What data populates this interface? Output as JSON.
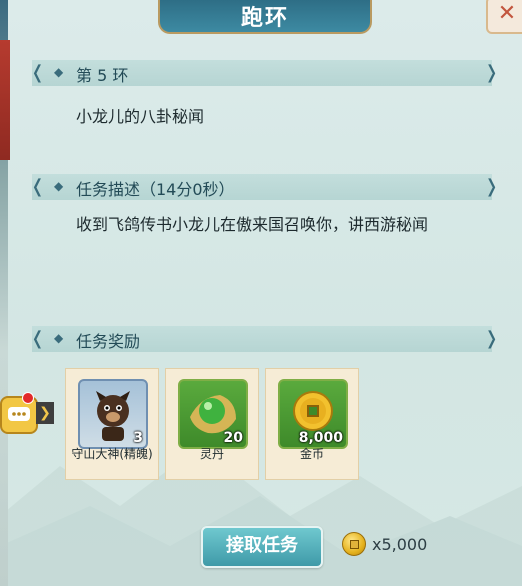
{
  "window": {
    "title": "跑环",
    "close_label": "✕"
  },
  "sections": {
    "ring": {
      "label": "第 5 环",
      "content": "小龙儿的八卦秘闻"
    },
    "description": {
      "label": "任务描述（14分0秒）",
      "content": "收到飞鸽传书小龙儿在傲来国召唤你，讲西游秘闻"
    },
    "rewards": {
      "label": "任务奖励",
      "items": [
        {
          "name": "守山大神(精魄)",
          "count": "3",
          "icon": "spirit-dog-icon"
        },
        {
          "name": "灵丹",
          "count": "20",
          "icon": "elixir-icon"
        },
        {
          "name": "金币",
          "count": "8,000",
          "icon": "gold-coin-icon"
        }
      ]
    }
  },
  "actions": {
    "accept_label": "接取任务",
    "cost": "x5,000"
  },
  "colors": {
    "accent": "#3f9aa8",
    "title_bar": "#2e6e86"
  }
}
